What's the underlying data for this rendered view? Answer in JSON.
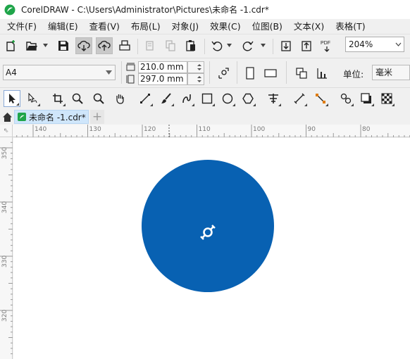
{
  "window": {
    "title": "CorelDRAW - C:\\Users\\Administrator\\Pictures\\未命名 -1.cdr*"
  },
  "menu": {
    "items": [
      "文件(F)",
      "编辑(E)",
      "查看(V)",
      "布局(L)",
      "对象(J)",
      "效果(C)",
      "位图(B)",
      "文本(X)",
      "表格(T)"
    ]
  },
  "toolbar": {
    "zoom_value": "204%",
    "pdf_label": "PDF"
  },
  "property_bar": {
    "page_size": "A4",
    "width": "210.0 mm",
    "height": "297.0 mm",
    "units_label": "单位:",
    "units_value": "毫米"
  },
  "document": {
    "tab_label": "未命名 -1.cdr*",
    "add_tab_label": "+"
  },
  "rulers": {
    "corner_glyph": "⇖",
    "horizontal_labels": [
      "140",
      "130",
      "120",
      "110",
      "100",
      "90",
      "80"
    ],
    "vertical_labels": [
      "350",
      "340",
      "330",
      "320"
    ]
  },
  "canvas": {
    "shape": "ellipse",
    "fill_color": "#0861b2"
  },
  "colors": {
    "accent": "#0861b2",
    "tab_active": "#cfe6fb"
  }
}
